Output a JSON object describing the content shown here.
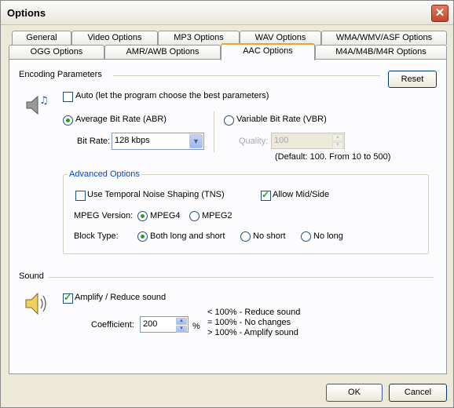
{
  "window": {
    "title": "Options"
  },
  "tabs_row1": [
    "General",
    "Video Options",
    "MP3 Options",
    "WAV Options",
    "WMA/WMV/ASF Options"
  ],
  "tabs_row2": [
    "OGG Options",
    "AMR/AWB Options",
    "AAC Options",
    "M4A/M4B/M4R Options"
  ],
  "active_tab": "AAC Options",
  "encoding": {
    "section_label": "Encoding Parameters",
    "reset_label": "Reset",
    "auto_label": "Auto (let the program choose the best parameters)",
    "auto_checked": false,
    "abr_label": "Average Bit Rate (ABR)",
    "abr_selected": true,
    "vbr_label": "Variable Bit Rate (VBR)",
    "vbr_selected": false,
    "bitrate_label": "Bit Rate:",
    "bitrate_value": "128 kbps",
    "quality_label": "Quality:",
    "quality_value": "100",
    "quality_hint": "(Default: 100. From 10 to 500)"
  },
  "advanced": {
    "title": "Advanced Options",
    "tns_label": "Use Temporal Noise Shaping (TNS)",
    "tns_checked": false,
    "midside_label": "Allow Mid/Side",
    "midside_checked": true,
    "mpeg_label": "MPEG Version:",
    "mpeg4_label": "MPEG4",
    "mpeg2_label": "MPEG2",
    "mpeg_selected": "MPEG4",
    "block_label": "Block Type:",
    "block_options": [
      "Both long and short",
      "No short",
      "No long"
    ],
    "block_selected": "Both long and short"
  },
  "sound": {
    "section_label": "Sound",
    "amplify_label": "Amplify / Reduce sound",
    "amplify_checked": true,
    "coef_label": "Coefficient:",
    "coef_value": "200",
    "coef_unit": "%",
    "legend": [
      "< 100% - Reduce sound",
      "= 100% - No changes",
      "> 100% - Amplify sound"
    ]
  },
  "footer": {
    "ok_label": "OK",
    "cancel_label": "Cancel"
  }
}
